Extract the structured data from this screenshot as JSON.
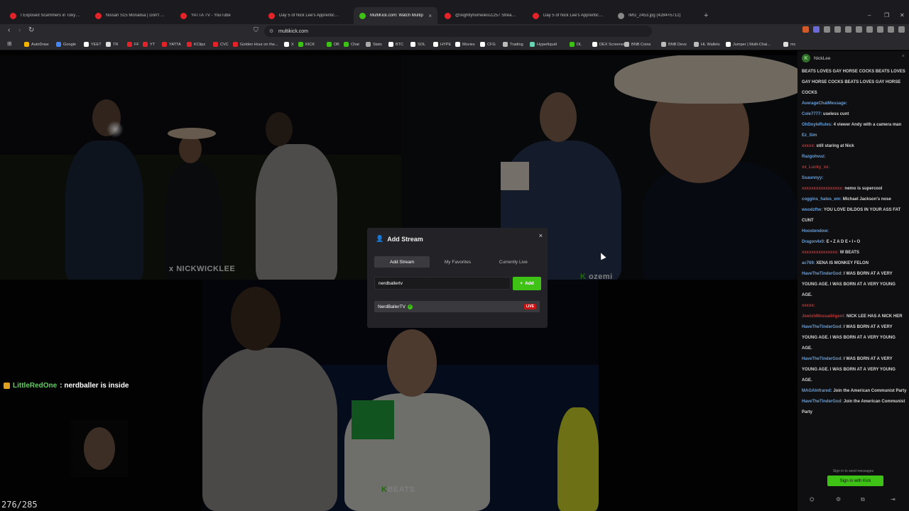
{
  "browser": {
    "tabs": [
      {
        "label": "I Exposed Scammers in Tokyo! *attac",
        "color": "#e3232a",
        "active": false
      },
      {
        "label": "Nissan S15 Monalisa | Don't Leave Th",
        "color": "#e3232a",
        "active": false
      },
      {
        "label": "YATTA TV - YouTube",
        "color": "#e3232a",
        "active": false
      },
      {
        "label": "Day 5 of Nick Lee's Apprentice Event",
        "color": "#e3232a",
        "active": false
      },
      {
        "label": "MultiKick.com: Watch Multip",
        "color": "#3ec215",
        "active": true
      },
      {
        "label": "@slightlyhomeless1257 Stream Snip",
        "color": "#e3232a",
        "active": false
      },
      {
        "label": "Day 5 of Nick Lee's Apprentice Event",
        "color": "#e3232a",
        "active": false
      },
      {
        "label": "IMG_2453.jpg (4284×5712)",
        "color": "#888888",
        "active": false
      }
    ],
    "tab_close": "×",
    "new_tab": "+",
    "window_controls": [
      "–",
      "❐",
      "✕"
    ],
    "url": "multikick.com",
    "nav": {
      "back": "‹",
      "forward": "›",
      "reload": "↻"
    },
    "bookmarks": [
      {
        "label": "AutoDraw",
        "color": "#f4b400"
      },
      {
        "label": "Google",
        "color": "#4285f4"
      },
      {
        "label": "YEET",
        "color": "#ffffff"
      },
      {
        "label": "TR",
        "color": "#dddddd"
      },
      {
        "label": "FF",
        "color": "#e3232a"
      },
      {
        "label": "YT",
        "color": "#e3232a"
      },
      {
        "label": "YATTA",
        "color": "#e3232a"
      },
      {
        "label": "KClipz",
        "color": "#e3232a"
      },
      {
        "label": "CVC",
        "color": "#e3232a"
      },
      {
        "label": "Golden Hour on the...",
        "color": "#e3232a"
      },
      {
        "label": "X",
        "color": "#ffffff"
      },
      {
        "label": "KICK",
        "color": "#3ec215"
      },
      {
        "label": "DB",
        "color": "#3ec215"
      },
      {
        "label": "Chat",
        "color": "#3ec215"
      },
      {
        "label": "Stats",
        "color": "#aaaaaa"
      },
      {
        "label": "BTC",
        "color": "#ffffff"
      },
      {
        "label": "SOL",
        "color": "#ffffff"
      },
      {
        "label": "HYPE",
        "color": "#ffffff"
      },
      {
        "label": "Movies",
        "color": "#ffffff"
      },
      {
        "label": "CFG",
        "color": "#ffffff"
      },
      {
        "label": "Trading",
        "color": "#bbbbbb"
      },
      {
        "label": "Hyperliquid",
        "color": "#6ad3b5"
      },
      {
        "label": "DL",
        "color": "#3ec215"
      },
      {
        "label": "DEX Screener",
        "color": "#ffffff"
      },
      {
        "label": "BNB Coins",
        "color": "#bbbbbb"
      },
      {
        "label": "BNB Devs",
        "color": "#bbbbbb"
      },
      {
        "label": "HL Wallets",
        "color": "#bbbbbb"
      },
      {
        "label": "Jumper | Multi-Chai...",
        "color": "#ffffff"
      },
      {
        "label": "mc",
        "color": "#dddddd"
      }
    ]
  },
  "videos": {
    "top_left_label": "NICKWICKLEE",
    "top_right_label": "ozemi",
    "bottom_label": "BEATS",
    "overlay_user": "LittleRedOne",
    "overlay_message": ": nerdballer is inside",
    "frame_counter": "276/285"
  },
  "modal": {
    "title": "Add Stream",
    "close": "×",
    "tabs": [
      "Add Stream",
      "My Favorites",
      "Currently Live"
    ],
    "input_value": "nerdballertv",
    "add_button": "Add",
    "result_name": "NerdBallerTV",
    "result_verified": "✓",
    "result_badge": "LIVE"
  },
  "chat": {
    "streamer": "NickLee",
    "avatar_letter": "K",
    "messages": [
      {
        "user": "",
        "text": "BEATS LOVES GAY HORSE COCKS BEATS LOVES GAY HORSE COCKS BEATS LOVES GAY HORSE COCKS",
        "uclass": ""
      },
      {
        "user": "AverageChatMessage:",
        "text": "",
        "uclass": ""
      },
      {
        "user": "Cole7777:",
        "text": " useless cunt",
        "uclass": ""
      },
      {
        "user": "OhDoyleRules:",
        "text": " 4 viewer Andy with a camera man",
        "uclass": ""
      },
      {
        "user": "Ez_Sim",
        "text": "",
        "uclass": ""
      },
      {
        "user": "xxxxx:",
        "text": " still staring at Nick",
        "uclass": "red"
      },
      {
        "user": "Razgohvuz:",
        "text": "",
        "uclass": ""
      },
      {
        "user": "xx_Lucky_xx:",
        "text": "",
        "uclass": "red"
      },
      {
        "user": "Ssaunnyy:",
        "text": "",
        "uclass": ""
      },
      {
        "user": "xxxxxxxxxxxxxxxxx:",
        "text": " nemo is supercool",
        "uclass": "red"
      },
      {
        "user": "coggins_hates_em:",
        "text": " Michael Jackson's nose",
        "uclass": ""
      },
      {
        "user": "woodzftw:",
        "text": " YOU LOVE DILDOS IN YOUR ASS FAT CUNT",
        "uclass": ""
      },
      {
        "user": "Hoostendow:",
        "text": "",
        "uclass": ""
      },
      {
        "user": "Dragon4x0:",
        "text": " E • Z A D E • I • O",
        "uclass": ""
      },
      {
        "user": "xxxxxxxxxxxxxxx:",
        "text": " W BEATS",
        "uclass": "red"
      },
      {
        "user": "ac769:",
        "text": " XENA IS MONKEY FELON",
        "uclass": ""
      },
      {
        "user": "HaveTheTinderGod:",
        "text": " I WAS BORN AT A VERY YOUNG AGE. I WAS BORN AT A VERY YOUNG AGE.",
        "uclass": ""
      },
      {
        "user": "xxxxx:",
        "text": "",
        "uclass": "red"
      },
      {
        "user": "JewishMossadAgent:",
        "text": " NICK LEE HAS A NICK HER",
        "uclass": "red"
      },
      {
        "user": "HaveTheTinderGod:",
        "text": " I WAS BORN AT A VERY YOUNG AGE. I WAS BORN AT A VERY YOUNG AGE.",
        "uclass": ""
      },
      {
        "user": "HaveTheTinderGod:",
        "text": " I WAS BORN AT A VERY YOUNG AGE. I WAS BORN AT A VERY YOUNG AGE.",
        "uclass": ""
      },
      {
        "user": "MAGAInfrared:",
        "text": " Join the American Communist Party",
        "uclass": ""
      },
      {
        "user": "HaveTheTinderGod:",
        "text": " Join the American Communist Party",
        "uclass": ""
      }
    ],
    "signin_text": "Sign in to send messages",
    "signin_button": "Sign in with Kick"
  }
}
